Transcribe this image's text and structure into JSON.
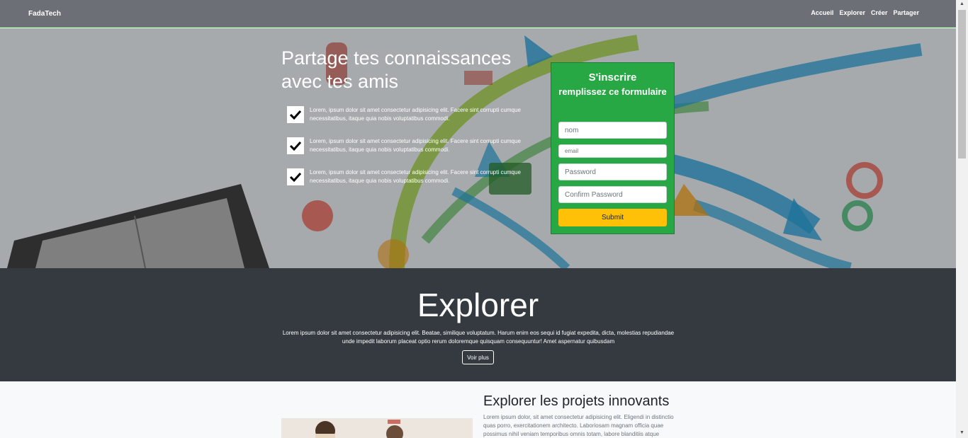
{
  "navbar": {
    "brand": "FadaTech",
    "links": [
      "Accueil",
      "Explorer",
      "Créer",
      "Partager"
    ]
  },
  "hero": {
    "title": "Partage tes connaissances avec tes amis",
    "features": [
      "Lorem, ipsum dolor sit amet consectetur adipisicing elit. Facere sint corrupti cumque necessitatibus, itaque quia nobis voluptatibus commodi.",
      "Lorem, ipsum dolor sit amet consectetur adipisicing elit. Facere sint corrupti cumque necessitatibus, itaque quia nobis voluptatibus commodi.",
      "Lorem, ipsum dolor sit amet consectetur adipisicing elit. Facere sint corrupti cumque necessitatibus, itaque quia nobis voluptatibus commodi."
    ]
  },
  "signup": {
    "title": "S'inscrire",
    "subtitle": "remplissez ce formulaire",
    "nom_placeholder": "nom",
    "email_placeholder": "email",
    "password_placeholder": "Password",
    "confirm_placeholder": "Confirm Password",
    "submit_label": "Submit"
  },
  "explorer": {
    "title": "Explorer",
    "text": "Lorem ipsum dolor sit amet consectetur adipisicing elit. Beatae, similique voluptatum. Harum enim eos sequi id fugiat expedita, dicta, molestias repudiandae unde impedit laborum placeat optio rerum doloremque quisquam consequuntur! Amet aspernatur quibusdam",
    "button_label": "Voir plus"
  },
  "projects": {
    "title": "Explorer les projets innovants",
    "text": "Lorem ipsum dolor, sit amet consectetur adipisicing elit. Eligendi in distinctio quas porro, exercitationem architecto. Laboriosam magnam officia quae possimus nihil veniam temporibus omnis totam, labore blanditiis atque"
  },
  "colors": {
    "navbar": "#6c6f75",
    "form_green": "#28a745",
    "submit_yellow": "#ffc107",
    "explorer_bg": "#343a40"
  }
}
